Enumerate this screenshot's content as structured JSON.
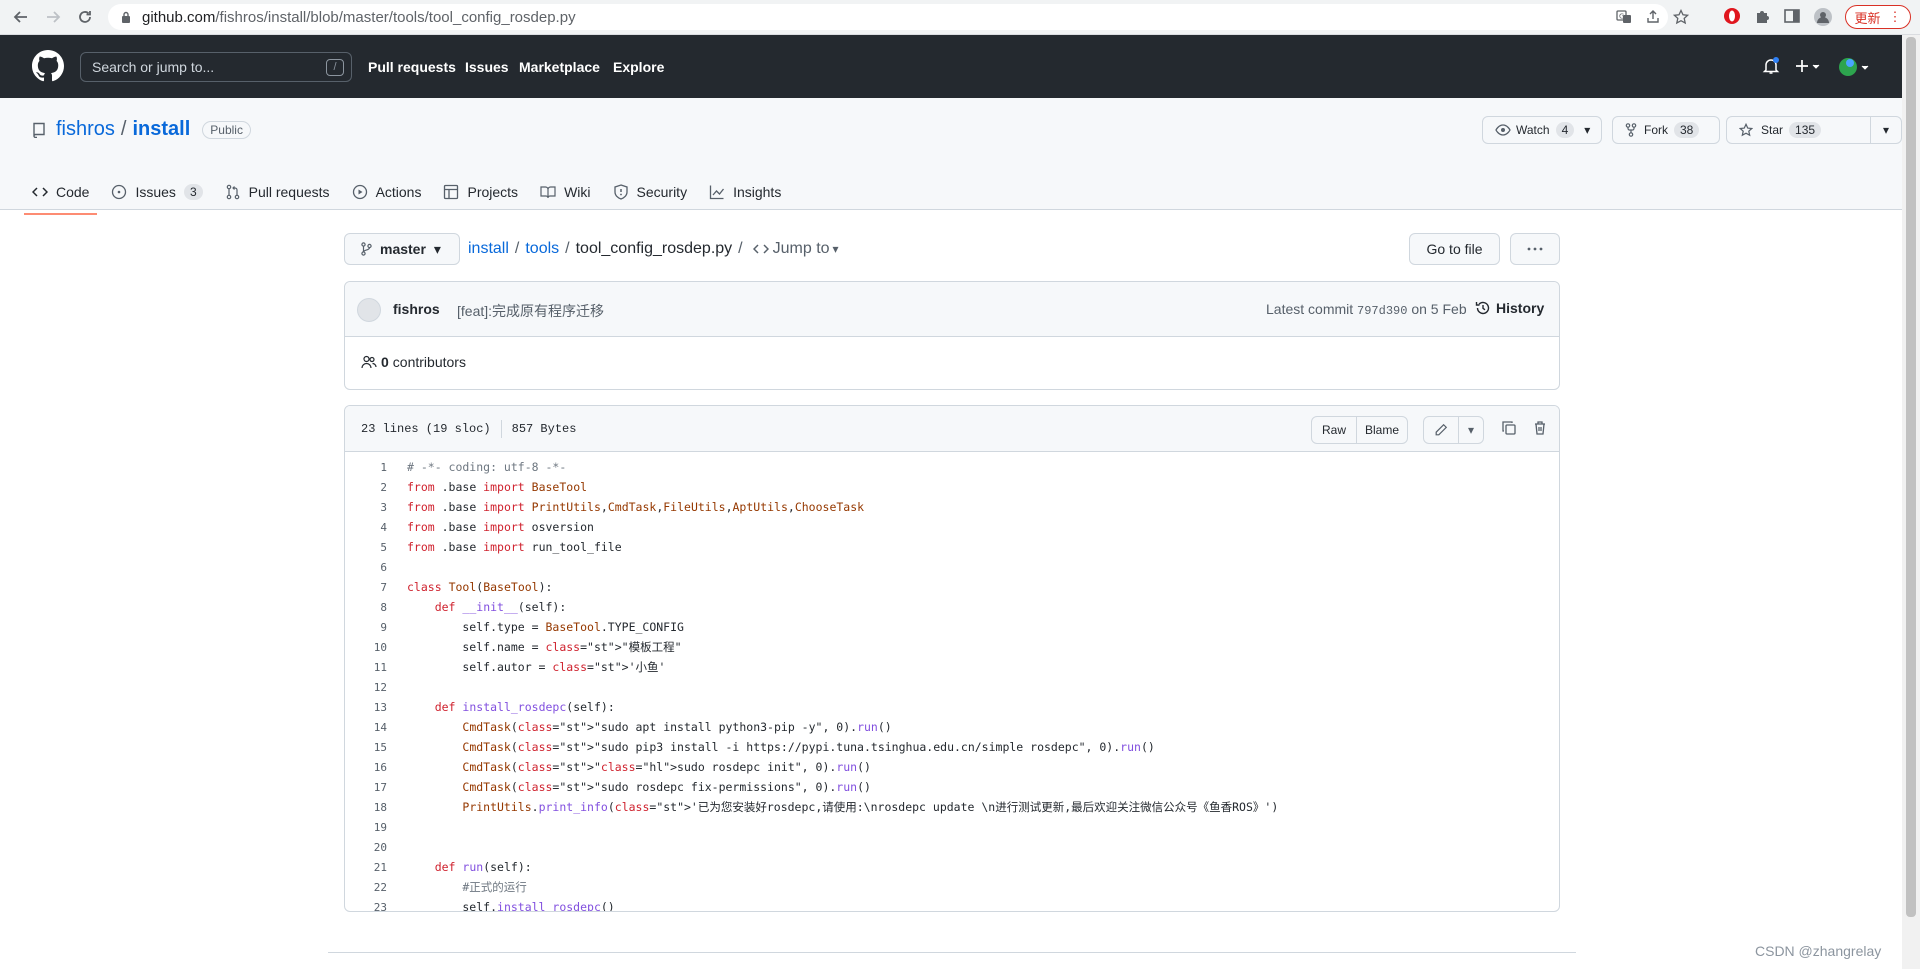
{
  "browser": {
    "url_host": "github.com",
    "url_path": "/fishros/install/blob/master/tools/tool_config_rosdep.py",
    "update_label": "更新"
  },
  "header": {
    "search_placeholder": "Search or jump to...",
    "search_key": "/",
    "nav": [
      "Pull requests",
      "Issues",
      "Marketplace",
      "Explore"
    ]
  },
  "repo": {
    "owner": "fishros",
    "name": "install",
    "visibility": "Public",
    "watch_label": "Watch",
    "watch_count": "4",
    "fork_label": "Fork",
    "fork_count": "38",
    "star_label": "Star",
    "star_count": "135"
  },
  "tabs": [
    {
      "label": "Code",
      "icon": "code-icon",
      "active": true
    },
    {
      "label": "Issues",
      "icon": "issue-icon",
      "count": "3"
    },
    {
      "label": "Pull requests",
      "icon": "pull-request-icon"
    },
    {
      "label": "Actions",
      "icon": "play-icon"
    },
    {
      "label": "Projects",
      "icon": "table-icon"
    },
    {
      "label": "Wiki",
      "icon": "book-icon"
    },
    {
      "label": "Security",
      "icon": "shield-icon"
    },
    {
      "label": "Insights",
      "icon": "graph-icon"
    }
  ],
  "file_nav": {
    "branch": "master",
    "crumbs": [
      "install",
      "tools"
    ],
    "file": "tool_config_rosdep.py",
    "jump_label": "Jump to",
    "goto_label": "Go to file"
  },
  "commit": {
    "author": "fishros",
    "message": "[feat]:完成原有程序迁移",
    "latest_label": "Latest commit",
    "sha": "797d390",
    "date": "on 5 Feb",
    "history_label": "History",
    "contributors_count": "0",
    "contributors_label": "contributors"
  },
  "file": {
    "lines_info": "23 lines (19 sloc)",
    "size": "857 Bytes",
    "raw_label": "Raw",
    "blame_label": "Blame",
    "code_lines": [
      "# -*- coding: utf-8 -*-",
      "from .base import BaseTool",
      "from .base import PrintUtils,CmdTask,FileUtils,AptUtils,ChooseTask",
      "from .base import osversion",
      "from .base import run_tool_file",
      "",
      "class Tool(BaseTool):",
      "    def __init__(self):",
      "        self.type = BaseTool.TYPE_CONFIG",
      "        self.name = \"模板工程\"",
      "        self.autor = '小鱼'",
      "",
      "    def install_rosdepc(self):",
      "        CmdTask(\"sudo apt install python3-pip -y\", 0).run()",
      "        CmdTask(\"sudo pip3 install -i https://pypi.tuna.tsinghua.edu.cn/simple rosdepc\", 0).run()",
      "        CmdTask(\"sudo rosdepc init\", 0).run()",
      "        CmdTask(\"sudo rosdepc fix-permissions\", 0).run()",
      "        PrintUtils.print_info('已为您安装好rosdepc,请使用:\\nrosdepc update \\n进行测试更新,最后欢迎关注微信公众号《鱼香ROS》')",
      "",
      "",
      "    def run(self):",
      "        #正式的运行",
      "        self.install_rosdepc()"
    ]
  },
  "watermark": "CSDN @zhangrelay"
}
